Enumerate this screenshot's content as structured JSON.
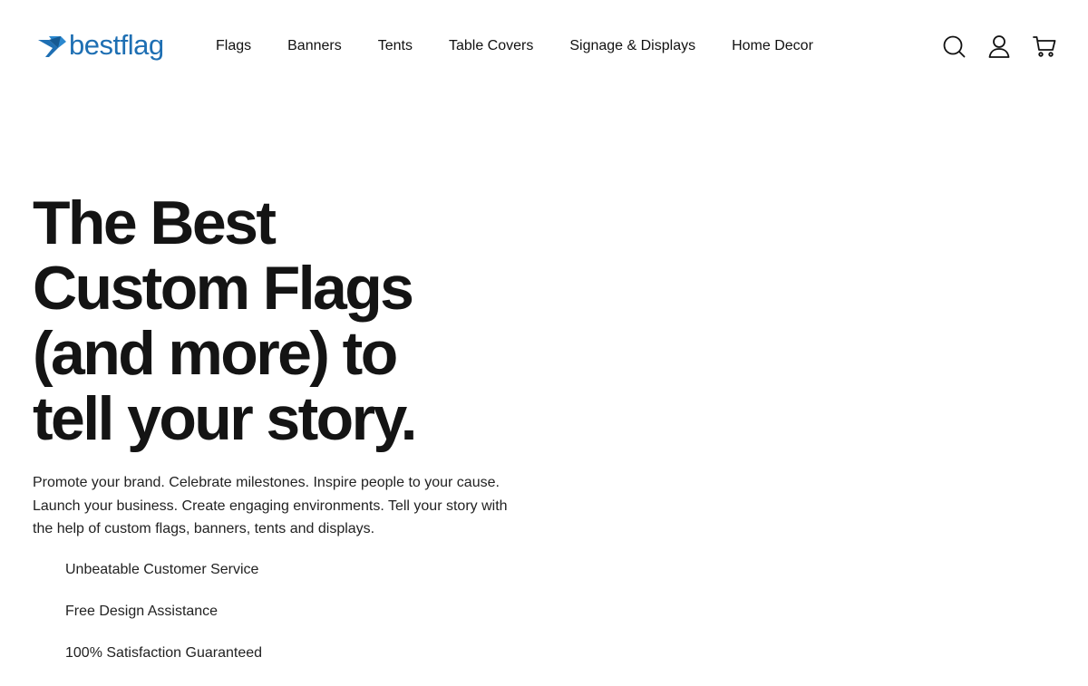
{
  "header": {
    "logo_text": "bestflag",
    "brand_color": "#1e6fb3",
    "nav": [
      {
        "label": "Flags"
      },
      {
        "label": "Banners"
      },
      {
        "label": "Tents"
      },
      {
        "label": "Table Covers"
      },
      {
        "label": "Signage & Displays"
      },
      {
        "label": "Home Decor"
      }
    ],
    "icons": [
      "search-icon",
      "account-icon",
      "cart-icon"
    ]
  },
  "hero": {
    "title_lines": [
      "The Best",
      "Custom Flags",
      "(and more) to",
      "tell your story."
    ],
    "description": "Promote your brand. Celebrate milestones. Inspire people to your cause. Launch your business. Create engaging environments. Tell your story with the help of custom flags, banners, tents and displays.",
    "features": [
      "Unbeatable Customer Service",
      "Free Design Assistance",
      "100% Satisfaction Guaranteed"
    ]
  }
}
